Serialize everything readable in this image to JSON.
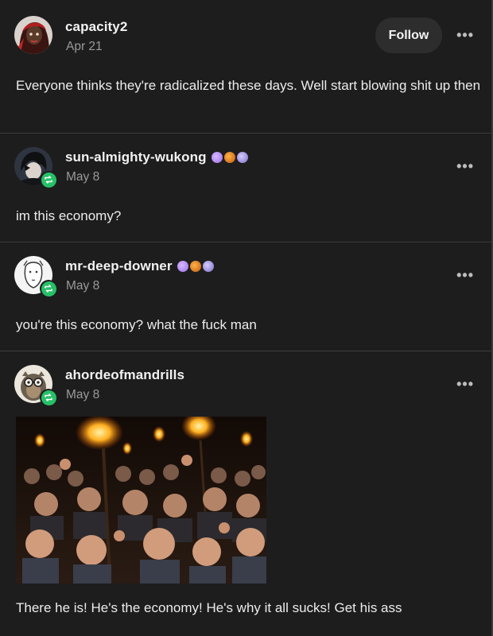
{
  "posts": [
    {
      "username": "capacity2",
      "date": "Apr 21",
      "follow_label": "Follow",
      "more_label": "•••",
      "text": "Everyone thinks they're radicalized these days. Well start blowing shit up then",
      "avatar_icon": "avatar-woman-red"
    },
    {
      "username": "sun-almighty-wukong",
      "date": "May 8",
      "more_label": "•••",
      "text": "im this economy?",
      "badges": [
        "purple-badge",
        "orange-badge",
        "lavender-badge"
      ],
      "avatar_icon": "avatar-dark-character"
    },
    {
      "username": "mr-deep-downer",
      "date": "May 8",
      "more_label": "•••",
      "text": "you're this economy? what the fuck man",
      "badges": [
        "purple-badge",
        "orange-badge",
        "lavender-badge"
      ],
      "avatar_icon": "avatar-sketch-face"
    },
    {
      "username": "ahordeofmandrills",
      "date": "May 8",
      "more_label": "•••",
      "text": "There he is! He's the economy! He's why it all sucks! Get his ass",
      "avatar_icon": "avatar-mandrill-glasses",
      "image_description_icon": "angry-mob-with-torches-image"
    }
  ],
  "colors": {
    "background": "#1d1d1d",
    "reblog_green": "#27c068",
    "text": "#ececec",
    "muted": "#9a9a9a"
  }
}
